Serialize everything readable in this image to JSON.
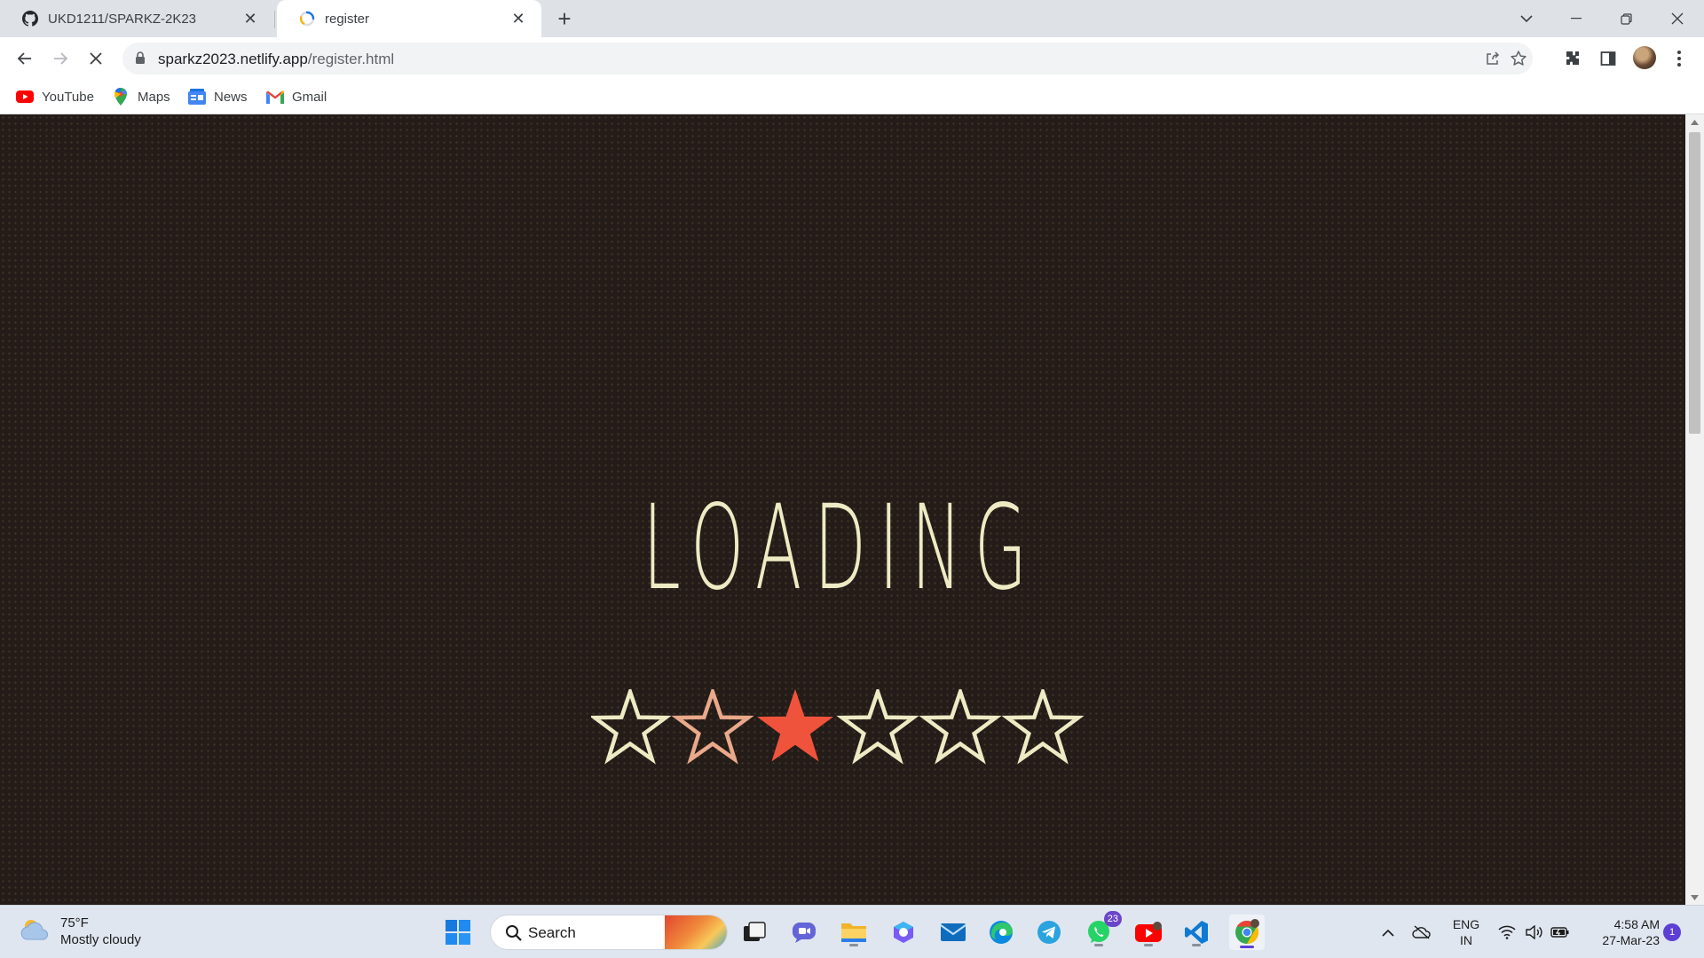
{
  "browser": {
    "tabs": [
      {
        "title": "UKD1211/SPARKZ-2K23",
        "icon": "github-icon"
      },
      {
        "title": "register",
        "icon": "loading-spinner-icon"
      }
    ],
    "url_host": "sparkz2023.netlify.app",
    "url_path": "/register.html",
    "bookmarks": [
      {
        "label": "YouTube",
        "icon": "youtube-icon"
      },
      {
        "label": "Maps",
        "icon": "maps-icon"
      },
      {
        "label": "News",
        "icon": "news-icon"
      },
      {
        "label": "Gmail",
        "icon": "gmail-icon"
      }
    ]
  },
  "page": {
    "loading_text": "LOADING",
    "star_count": 6,
    "colors": {
      "background": "#231c18",
      "text": "#ecebc4",
      "star_outline": "#ecebc4",
      "star_trailing": "#e9a98a",
      "star_active": "#f0533c"
    }
  },
  "taskbar": {
    "weather_temp": "75°F",
    "weather_desc": "Mostly cloudy",
    "search_label": "Search",
    "whatsapp_badge": "23",
    "lang_line1": "ENG",
    "lang_line2": "IN",
    "time": "4:58 AM",
    "date": "27-Mar-23",
    "notification_count": "1"
  }
}
